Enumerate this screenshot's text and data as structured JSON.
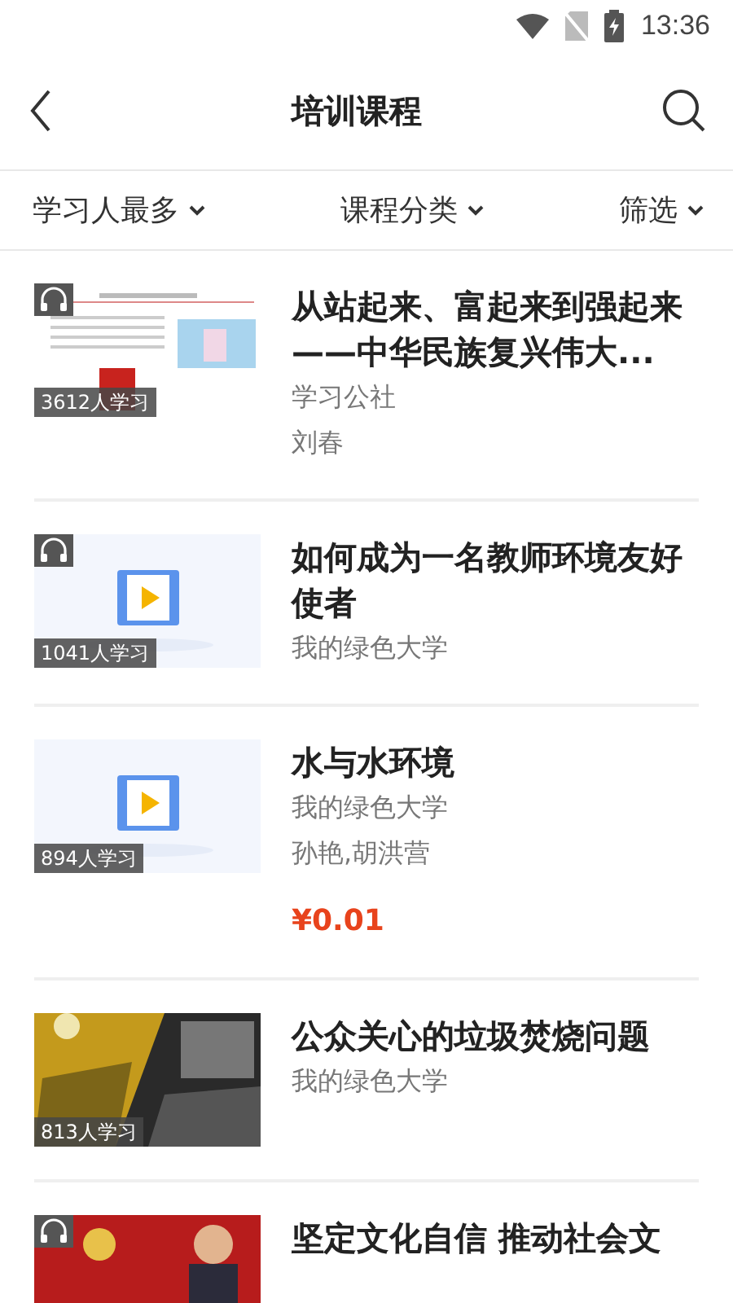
{
  "status_bar": {
    "time": "13:36"
  },
  "header": {
    "title": "培训课程"
  },
  "filters": [
    {
      "label": "学习人最多"
    },
    {
      "label": "课程分类"
    },
    {
      "label": "筛选"
    }
  ],
  "courses": [
    {
      "title": "从站起来、富起来到强起来——中华民族复兴伟大...",
      "source": "学习公社",
      "author": "刘春",
      "learners": "3612人学习",
      "audio": true
    },
    {
      "title": "如何成为一名教师环境友好使者",
      "source": "我的绿色大学",
      "learners": "1041人学习",
      "audio": true
    },
    {
      "title": "水与水环境",
      "source": "我的绿色大学",
      "author": "孙艳,胡洪营",
      "price": "¥0.01",
      "learners": "894人学习",
      "audio": false
    },
    {
      "title": "公众关心的垃圾焚烧问题",
      "source": "我的绿色大学",
      "learners": "813人学习",
      "audio": false
    },
    {
      "title": "坚定文化自信 推动社会文",
      "audio": true
    }
  ]
}
